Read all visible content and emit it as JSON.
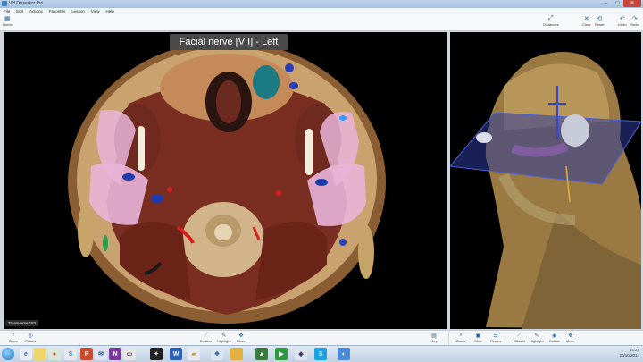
{
  "window": {
    "title": "VH Dissector Pro"
  },
  "window_controls": [
    "–",
    "□",
    "✕"
  ],
  "menu": [
    "File",
    "Edit",
    "Actions",
    "Favorites",
    "Lesson",
    "View",
    "Help"
  ],
  "ribbon": {
    "home": "Home",
    "right": [
      "Distances",
      "Clear",
      "Reset",
      "Undo",
      "Redo"
    ]
  },
  "left_pane": {
    "structure_label": "Facial nerve [VII] - Left",
    "slice_label": "Transverse 182"
  },
  "bottom_left_tools": {
    "left": [
      "Zoom",
      "Planes"
    ],
    "center": [
      "Dissect",
      "Highlight",
      "Move"
    ],
    "right": [
      "Key"
    ]
  },
  "bottom_right_tools": {
    "left": [
      "Zoom",
      "Slice",
      "Planes"
    ],
    "right": [
      "Dissect",
      "Highlight",
      "Rotate",
      "Move"
    ]
  },
  "taskbar": {
    "time": "14:29",
    "date": "20/10/2014"
  },
  "colors": {
    "titlebar": "#a6c1df",
    "highlight_pink": "#e9b4d8",
    "plane_blue": "#2d3a9c"
  }
}
